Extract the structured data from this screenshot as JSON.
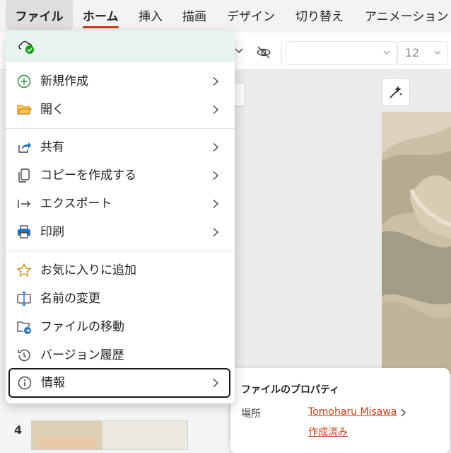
{
  "ribbon": {
    "tabs": [
      {
        "label": "ファイル"
      },
      {
        "label": "ホーム"
      },
      {
        "label": "挿入"
      },
      {
        "label": "描画"
      },
      {
        "label": "デザイン"
      },
      {
        "label": "切り替え"
      },
      {
        "label": "アニメーション"
      }
    ],
    "selected_tab": "ホーム"
  },
  "toolbar": {
    "font_name": "",
    "font_size": "12"
  },
  "file_menu": {
    "items": [
      {
        "label": "新規作成",
        "icon": "plus-circle-icon",
        "has_submenu": true
      },
      {
        "label": "開く",
        "icon": "folder-icon",
        "has_submenu": true
      },
      {
        "label": "共有",
        "icon": "share-icon",
        "has_submenu": true
      },
      {
        "label": "コピーを作成する",
        "icon": "copy-icon",
        "has_submenu": true
      },
      {
        "label": "エクスポート",
        "icon": "export-icon",
        "has_submenu": true
      },
      {
        "label": "印刷",
        "icon": "printer-icon",
        "has_submenu": true
      },
      {
        "label": "お気に入りに追加",
        "icon": "star-icon",
        "has_submenu": false
      },
      {
        "label": "名前の変更",
        "icon": "rename-icon",
        "has_submenu": false
      },
      {
        "label": "ファイルの移動",
        "icon": "move-file-icon",
        "has_submenu": false
      },
      {
        "label": "バージョン履歴",
        "icon": "history-icon",
        "has_submenu": false
      },
      {
        "label": "情報",
        "icon": "info-icon",
        "has_submenu": true
      }
    ],
    "selected_item": "情報"
  },
  "properties": {
    "title": "ファイルのプロパティ",
    "location_label": "場所",
    "location_value": "Tomoharu Misawa",
    "status": "作成済み"
  },
  "slides": {
    "thumbnail_number": "4"
  },
  "colors": {
    "accent": "#c43e1c",
    "sync_green": "#13a10e",
    "menu_header_bg": "#e8f4ee"
  }
}
